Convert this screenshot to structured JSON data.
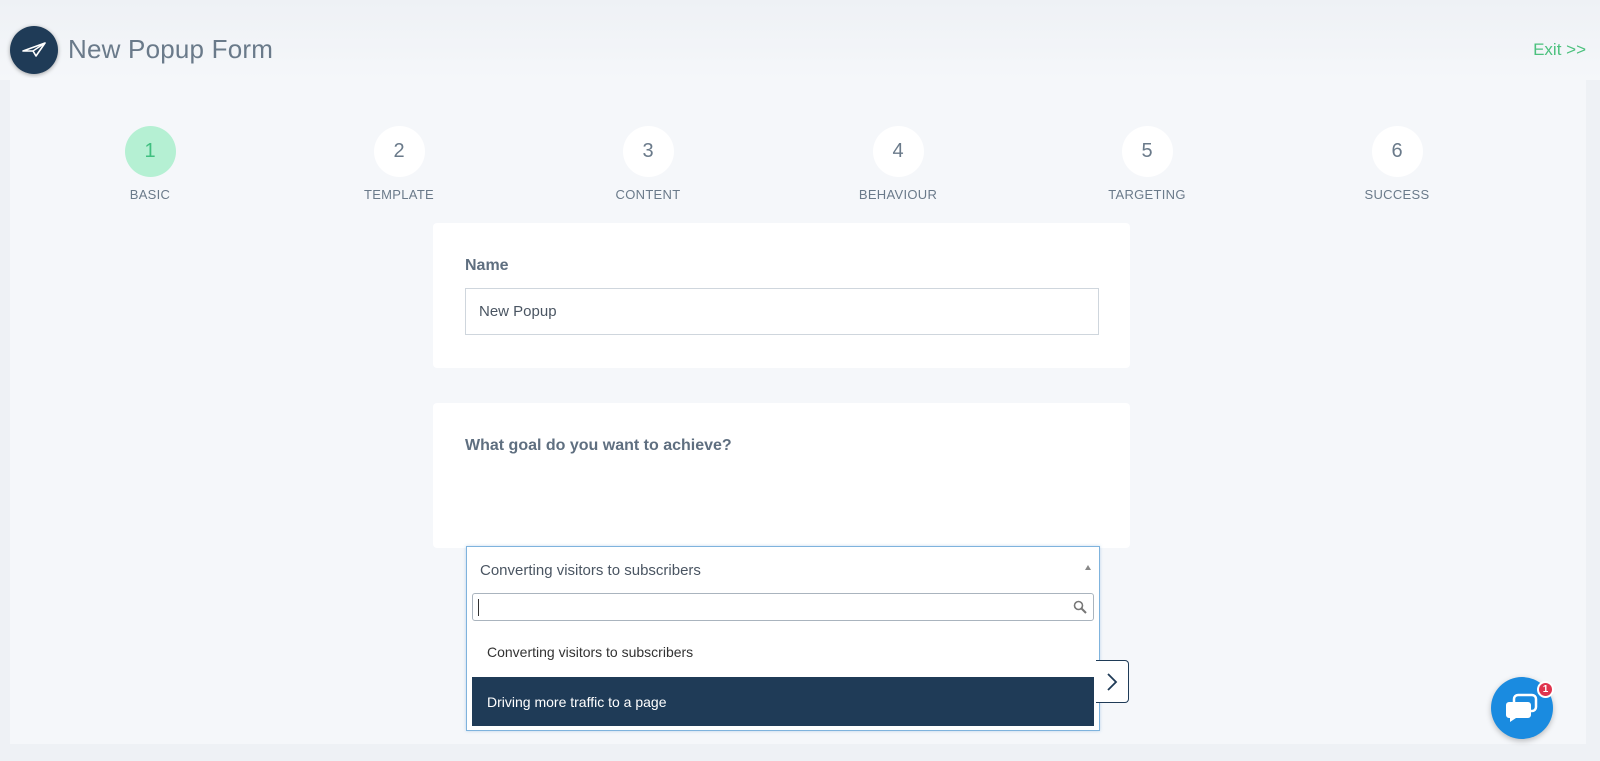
{
  "header": {
    "title": "New Popup Form",
    "exit_label": "Exit >>"
  },
  "steps": [
    {
      "number": "1",
      "label": "BASIC",
      "active": true
    },
    {
      "number": "2",
      "label": "TEMPLATE",
      "active": false
    },
    {
      "number": "3",
      "label": "CONTENT",
      "active": false
    },
    {
      "number": "4",
      "label": "BEHAVIOUR",
      "active": false
    },
    {
      "number": "5",
      "label": "TARGETING",
      "active": false
    },
    {
      "number": "6",
      "label": "SUCCESS",
      "active": false
    }
  ],
  "name_section": {
    "label": "Name",
    "value": "New Popup"
  },
  "goal_section": {
    "label": "What goal do you want to achieve?",
    "selected": "Converting visitors to subscribers",
    "search_value": "",
    "options": [
      {
        "label": "Converting visitors to subscribers",
        "highlighted": false
      },
      {
        "label": "Driving more traffic to a page",
        "highlighted": true
      }
    ]
  },
  "chat": {
    "badge_count": "1"
  },
  "colors": {
    "accent_green": "#4cc17e",
    "step_active_bg": "#b5f0d3",
    "navy": "#1f3b57",
    "chat_blue": "#1a8be0",
    "badge_red": "#e0344e"
  }
}
